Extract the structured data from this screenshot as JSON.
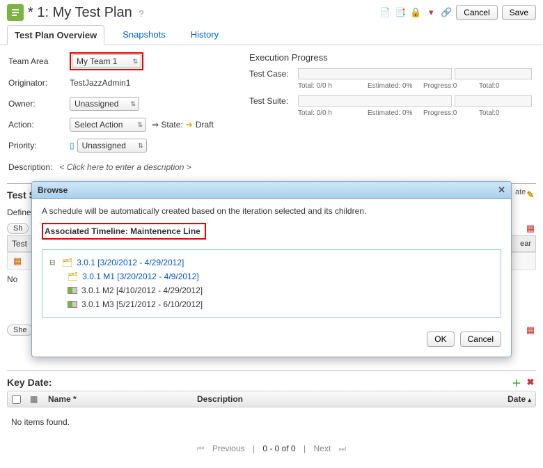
{
  "header": {
    "title_prefix": "*",
    "title_number": "1",
    "title_name": "My Test Plan",
    "cancel": "Cancel",
    "save": "Save"
  },
  "tabs": [
    {
      "label": "Test Plan Overview",
      "active": true
    },
    {
      "label": "Snapshots",
      "active": false
    },
    {
      "label": "History",
      "active": false
    }
  ],
  "form": {
    "team_area_label": "Team Area",
    "team_area_value": "My Team 1",
    "originator_label": "Originator:",
    "originator_value": "TestJazzAdmin1",
    "owner_label": "Owner:",
    "owner_value": "Unassigned",
    "action_label": "Action:",
    "action_value": "Select Action",
    "state_prefix": "⇒ State:",
    "state_value": "Draft",
    "priority_label": "Priority:",
    "priority_value": "Unassigned",
    "description_label": "Description:",
    "description_placeholder": "< Click here to enter a description >"
  },
  "exec": {
    "title": "Execution Progress",
    "test_case_label": "Test Case:",
    "test_suite_label": "Test Suite:",
    "stat_total": "Total: 0/0 h",
    "stat_estimated": "Estimated: 0%",
    "stat_progress": "Progress:0",
    "stat_total2": "Total:0"
  },
  "schedules": {
    "title": "Test Schedules",
    "define_label": "Define",
    "sh_label": "Sh",
    "test_label": "Test",
    "no_label": "No",
    "she_label": "She"
  },
  "keydate": {
    "title": "Key Date:",
    "col_name": "Name *",
    "col_desc": "Description",
    "col_date": "Date",
    "empty": "No items found."
  },
  "pager": {
    "prev": "Previous",
    "range": "0 - 0 of 0",
    "next": "Next"
  },
  "dialog": {
    "title": "Browse",
    "intro": "A schedule will be automatically created based on the iteration selected and its children.",
    "timeline_label": "Associated Timeline: Maintenence Line",
    "tree": {
      "root": "3.0.1 [3/20/2012 - 4/29/2012]",
      "m1": "3.0.1 M1 [3/20/2012 - 4/9/2012]",
      "m2": "3.0.1 M2 [4/10/2012 - 4/29/2012]",
      "m3": "3.0.1 M3 [5/21/2012 - 6/10/2012]"
    },
    "ok": "OK",
    "cancel": "Cancel",
    "side_label": "ate",
    "ear_label": "ear"
  }
}
